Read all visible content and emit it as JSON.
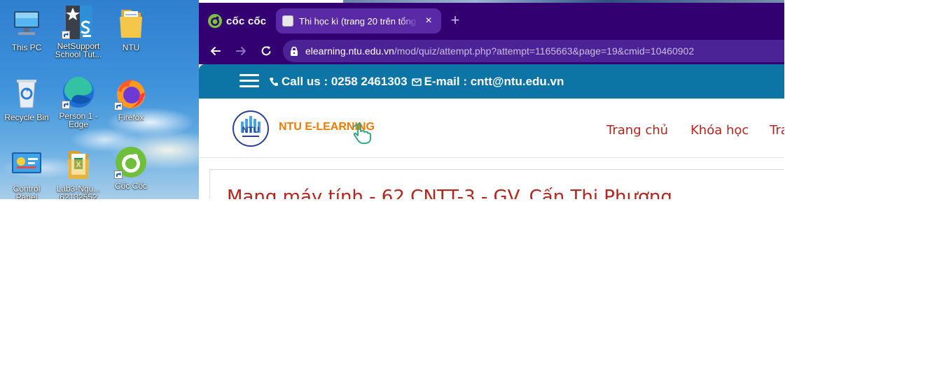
{
  "desktop": {
    "icons": [
      {
        "label": "This PC",
        "label2": ""
      },
      {
        "label": "NetSupport",
        "label2": "School Tut..."
      },
      {
        "label": "NTU",
        "label2": ""
      },
      {
        "label": "Recycle Bin",
        "label2": ""
      },
      {
        "label": "Person 1 -",
        "label2": "Edge"
      },
      {
        "label": "Firefox",
        "label2": ""
      },
      {
        "label": "Control",
        "label2": "Panel"
      },
      {
        "label": "Lab3-Ngu...",
        "label2": "62132552"
      },
      {
        "label": "Cốc Cốc",
        "label2": ""
      }
    ]
  },
  "browser": {
    "brand": "cốc cốc",
    "tab": {
      "title": "Thi học kì (trang 20 trên tổng",
      "close": "×"
    },
    "new_tab": "+",
    "address": {
      "host": "elearning.ntu.edu.vn",
      "path": "/mod/quiz/attempt.php?attempt=1165663&page=19&cmid=10460902"
    }
  },
  "page": {
    "topbar": {
      "call_label": "Call us : 0258 2461303",
      "email_label": "E-mail : cntt@ntu.edu.vn"
    },
    "logo_text": "NTU E-LEARNING",
    "logo_badge": "NTU",
    "nav": {
      "home": "Trang chủ",
      "courses": "Khóa học",
      "more": "Tra"
    },
    "course_title": "Mạng máy tính - 62 CNTT-3 - GV. Cấn Thị Phượng"
  },
  "colors": {
    "browser_chrome": "#330072",
    "topbar": "#0d74a6",
    "link_red": "#b3261e",
    "logo_orange": "#f27a00"
  }
}
